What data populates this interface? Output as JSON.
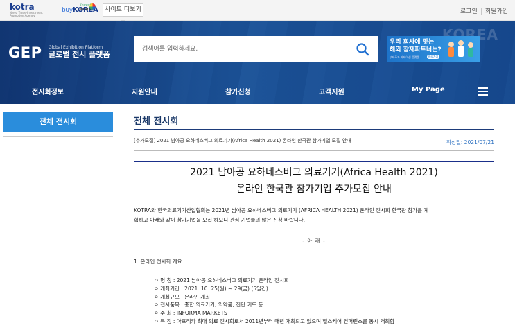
{
  "topbar": {
    "logos": {
      "kotra": "kotra",
      "kotra_sub": "Korea Trade-Investment Promotion Agency",
      "buykorea_prefix": "buy",
      "buykorea": "KOREA",
      "invest_line1": "Invest",
      "invest_line2": "KOREA"
    },
    "site_more": "사이트 더보기 +",
    "login": "로그인",
    "signup": "회원가입"
  },
  "header": {
    "brand": "GEP",
    "brand_en": "Global Exhibition Platform",
    "brand_kr": "글로벌 전시 플랫폼",
    "search_placeholder": "검색어를 입력하세요.",
    "banner": {
      "line1": "우리 회사에 맞는",
      "line2": "해외 참재파트너는?",
      "line3": "부제주자 제제이션 플랫폼",
      "pill": "바로가기"
    },
    "watermark": "KOREA",
    "nav": [
      "전시회정보",
      "지원안내",
      "참가신청",
      "고객지원",
      "My Page"
    ]
  },
  "sidebar": {
    "active": "전체 전시회"
  },
  "content": {
    "page_title": "전체 전시회",
    "notice_title": "[추가모집] 2021 남아공 요하네스버그 의료기기(Africa Health 2021) 온라인 한국관 참가기업 모집 안내",
    "notice_date": "작성일: 2021/07/21",
    "headline_line1": "2021 남아공 요하네스버그 의료기기(Africa Health 2021)",
    "headline_line2": "온라인 한국관 참가기업 추가모집 안내",
    "intro_line1": "KOTRA와 한국의료기기산업협회는 2021년 남아공 요하네스버그 의료기기 (AFRICA HEALTH 2021) 온라인 전시회 한국관 참가를 계",
    "intro_line2": "획하고 아래와 같이 참가기업을 모집 하오니 관심 기업들의 많은 신청 바랍니다.",
    "ar": "- 아 래 -",
    "section1": "1. 온라인 전시회 개요",
    "details": [
      "ㅇ 명   칭 : 2021 남아공 요하네스버그 의료기기 온라인 전시회",
      "ㅇ 개최기간 : 2021. 10. 25(월) ~ 29(금) (5일간)",
      "ㅇ 개최규모 : 온라인 개최",
      "ㅇ 전시품목 : 종합 의료기기, 의약품, 진단 키트 등",
      "ㅇ 주   최 : INFORMA MARKETS",
      "ㅇ 특   징 : 아프리카 최대 의료 전시회로서 2011년부터 매년 개최되고 있으며 헬스케어 컨퍼런스를 동시 개최함"
    ]
  }
}
